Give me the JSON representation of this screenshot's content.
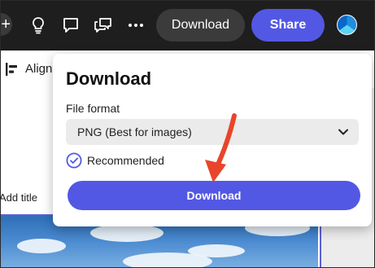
{
  "topbar": {
    "download_label": "Download",
    "share_label": "Share",
    "icons": [
      "add-icon",
      "lightbulb-icon",
      "comment-icon",
      "chat-icon",
      "more-icon"
    ]
  },
  "toolbar": {
    "align_label": "Align"
  },
  "canvas": {
    "add_title_label": "Add title"
  },
  "dialog": {
    "title": "Download",
    "file_format_label": "File format",
    "file_format_value": "PNG (Best for images)",
    "recommended_label": "Recommended",
    "download_button_label": "Download"
  },
  "colors": {
    "accent": "#5258e4",
    "annotation": "#e8452c",
    "topbar_bg": "#1e1e1e"
  }
}
